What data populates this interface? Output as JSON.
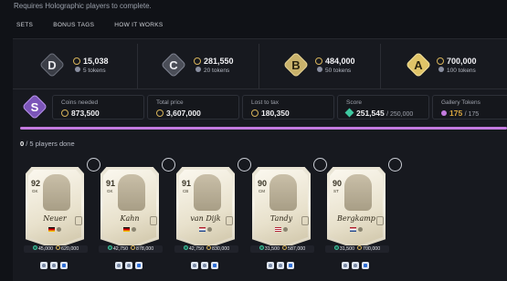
{
  "header": {
    "requirement": "Requires Holographic players to complete."
  },
  "tabs": [
    {
      "label": "SETS"
    },
    {
      "label": "BONUS TAGS"
    },
    {
      "label": "HOW IT WORKS"
    }
  ],
  "tiers": [
    {
      "letter": "D",
      "coins": "15,038",
      "tokens": "5 tokens",
      "color": "#5b5f6b"
    },
    {
      "letter": "C",
      "coins": "281,550",
      "tokens": "20 tokens",
      "color": "#6a6e7a"
    },
    {
      "letter": "B",
      "coins": "484,000",
      "tokens": "50 tokens",
      "color": "#c9b26b"
    },
    {
      "letter": "A",
      "coins": "700,000",
      "tokens": "100 tokens",
      "color": "#e0c468"
    }
  ],
  "summary": {
    "tier_letter": "S",
    "tier_color": "#a77be0",
    "coins_needed_label": "Coins needed",
    "coins_needed": "873,500",
    "total_price_label": "Total price",
    "total_price": "3,607,000",
    "lost_to_tax_label": "Lost to tax",
    "lost_to_tax": "180,350",
    "score_label": "Score",
    "score": "251,545",
    "score_max": "/ 250,000",
    "gallery_label": "Gallery Tokens",
    "gallery_value": "175",
    "gallery_max": "/ 175"
  },
  "progress": {
    "done": "0",
    "text": "/ 5 players done",
    "fraction": 1.0
  },
  "players": [
    {
      "rating": "92",
      "pos": "GK",
      "signature": "Neuer",
      "price1": "45,000",
      "price2": "620,000",
      "flag": "de"
    },
    {
      "rating": "91",
      "pos": "GK",
      "signature": "Kahn",
      "price1": "42,750",
      "price2": "878,000",
      "flag": "de"
    },
    {
      "rating": "91",
      "pos": "CB",
      "signature": "van Dijk",
      "price1": "42,750",
      "price2": "830,000",
      "flag": "nl"
    },
    {
      "rating": "90",
      "pos": "CM",
      "signature": "Tandy",
      "price1": "31,500",
      "price2": "587,000",
      "flag": "us"
    },
    {
      "rating": "90",
      "pos": "ST",
      "signature": "Bergkamp",
      "price1": "31,500",
      "price2": "700,000",
      "flag": "nl"
    }
  ]
}
